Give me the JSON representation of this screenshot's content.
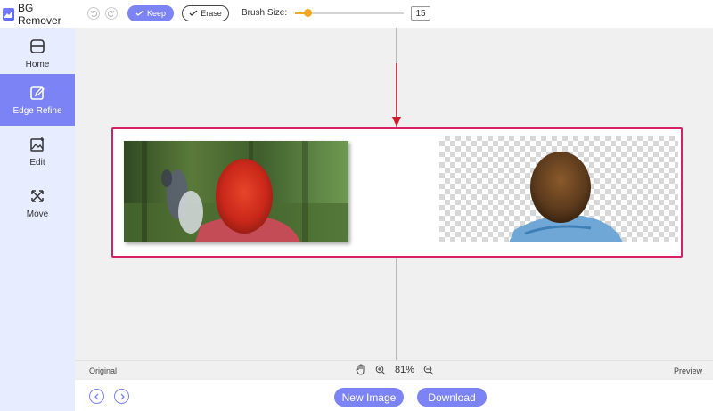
{
  "app": {
    "title": "BG Remover"
  },
  "sidebar": {
    "items": [
      {
        "label": "Home",
        "icon": "home-icon"
      },
      {
        "label": "Edge Refine",
        "icon": "edge-refine-icon",
        "active": true
      },
      {
        "label": "Edit",
        "icon": "edit-image-icon"
      },
      {
        "label": "Move",
        "icon": "move-icon"
      }
    ]
  },
  "toolbar": {
    "undo_icon": "undo-icon",
    "redo_icon": "redo-icon",
    "keep_label": "Keep",
    "erase_label": "Erase",
    "brush_label": "Brush Size:",
    "brush_value": "15"
  },
  "canvas": {
    "accent_color": "#d6206a",
    "arrow_color": "#d11a2a",
    "images": {
      "original": "photo of hikers in forest, woman with red hair in red jacket",
      "preview": "woman with brown hair in blue jacket on transparent background"
    }
  },
  "statusbar": {
    "left_label": "Original",
    "right_label": "Preview",
    "zoom": "81%"
  },
  "bottombar": {
    "new_image_label": "New Image",
    "download_label": "Download"
  },
  "colors": {
    "accent": "#7c83f5",
    "sidebar_bg": "#e8ecff",
    "slider": "#f5a623"
  }
}
